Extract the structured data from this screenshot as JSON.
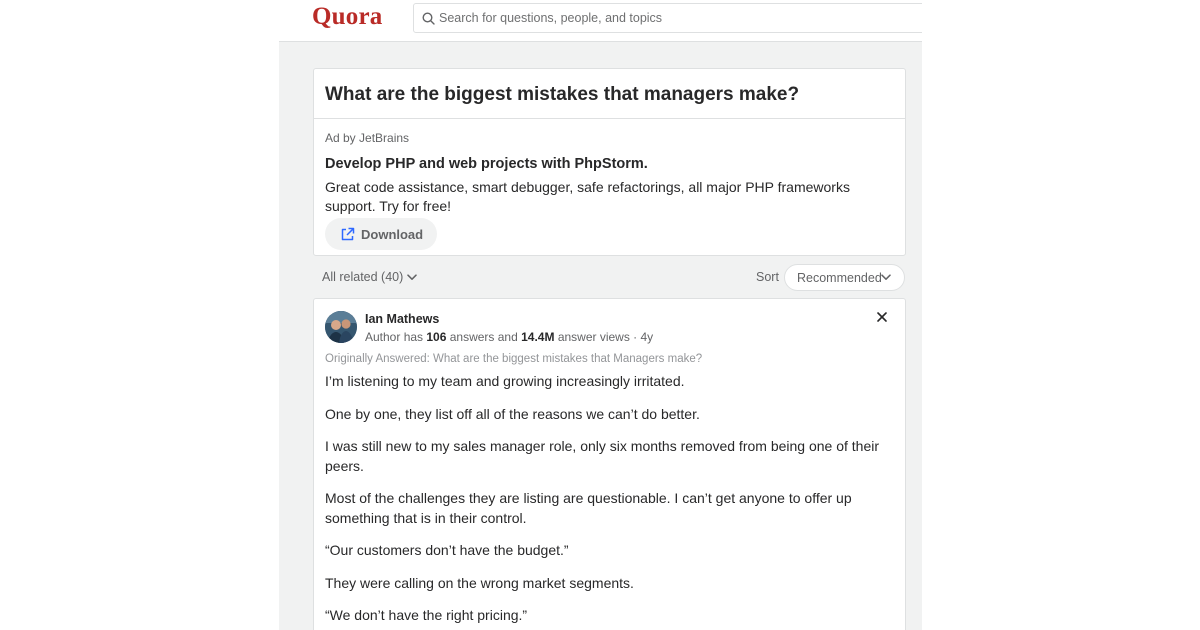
{
  "header": {
    "logo": "Quora",
    "search_placeholder": "Search for questions, people, and topics"
  },
  "question": {
    "title": "What are the biggest mistakes that managers make?"
  },
  "ad": {
    "by": "Ad by JetBrains",
    "headline": "Develop PHP and web projects with PhpStorm.",
    "body": "Great code assistance, smart debugger, safe refactorings, all major PHP frameworks support. Try for free!",
    "button": "Download"
  },
  "filters": {
    "related": "All related (40)",
    "sort_label": "Sort",
    "sort_value": "Recommended"
  },
  "answer": {
    "author": "Ian Mathews",
    "meta_prefix": "Author has ",
    "answers_count": "106",
    "meta_mid": " answers and ",
    "views_count": "14.4M",
    "meta_suffix": " answer views · 4y",
    "originally_answered": "Originally Answered: What are the biggest mistakes that Managers make?",
    "paragraphs": [
      "I’m listening to my team and growing increasingly irritated.",
      "One by one, they list off all of the reasons we can’t do better.",
      "I was still new to my sales manager role, only six months removed from being one of their peers.",
      "Most of the challenges they are listing are questionable. I can’t get anyone to offer up something that is in their control.",
      "“Our customers don’t have the budget.”",
      "They were calling on the wrong market segments.",
      "“We don’t have the right pricing.”"
    ]
  },
  "colors": {
    "brand": "#b92b27",
    "text": "#282829",
    "muted": "#636466",
    "background": "#f1f2f2",
    "border": "#dee0e1"
  },
  "icons": {
    "search": "search-icon",
    "external_link": "external-link-icon",
    "chevron": "chevron-down-icon",
    "close": "close-icon"
  }
}
